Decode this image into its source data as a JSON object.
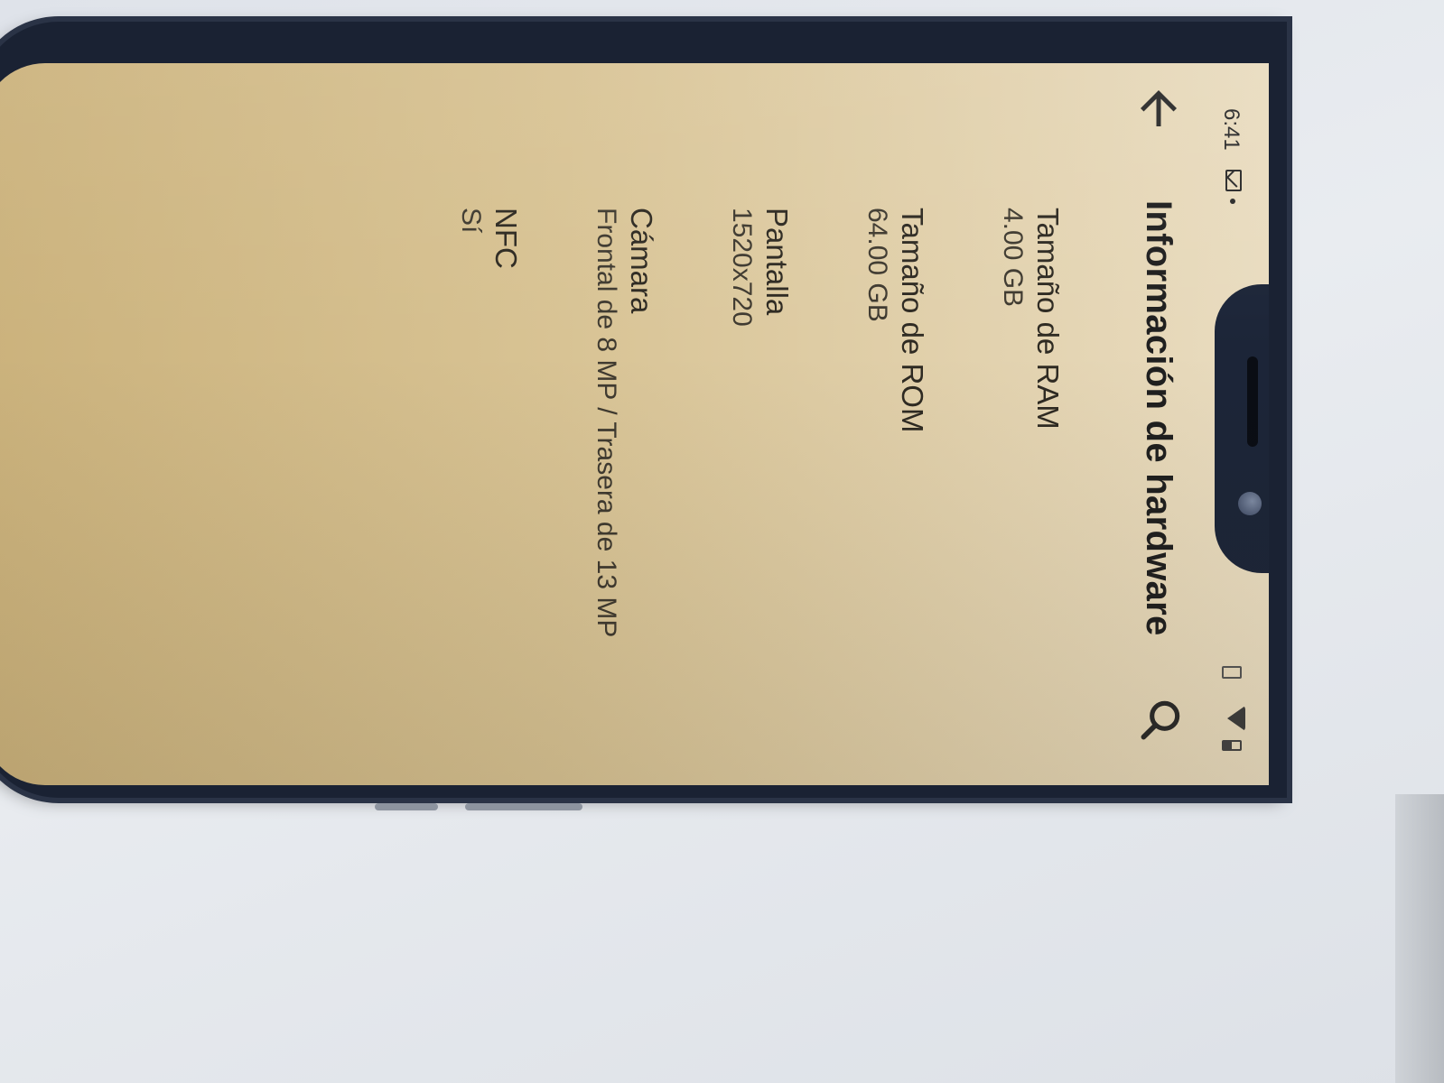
{
  "status_bar": {
    "time": "6:41",
    "icons": [
      "gmail-icon",
      "notification-dot-icon",
      "vibrate-icon",
      "wifi-icon",
      "battery-icon"
    ]
  },
  "toolbar": {
    "title": "Información de hardware",
    "back_icon": "arrow-back-icon",
    "search_icon": "search-icon"
  },
  "items": [
    {
      "label": "Tamaño de RAM",
      "value": "4.00 GB"
    },
    {
      "label": "Tamaño de ROM",
      "value": "64.00 GB"
    },
    {
      "label": "Pantalla",
      "value": "1520x720"
    },
    {
      "label": "Cámara",
      "value": "Frontal de 8 MP / Trasera de 13 MP"
    },
    {
      "label": "NFC",
      "value": "Sí"
    }
  ],
  "colors": {
    "screen_background": "#e1cfa6",
    "phone_frame": "#1a2233",
    "text_primary": "#1f1f1f"
  }
}
